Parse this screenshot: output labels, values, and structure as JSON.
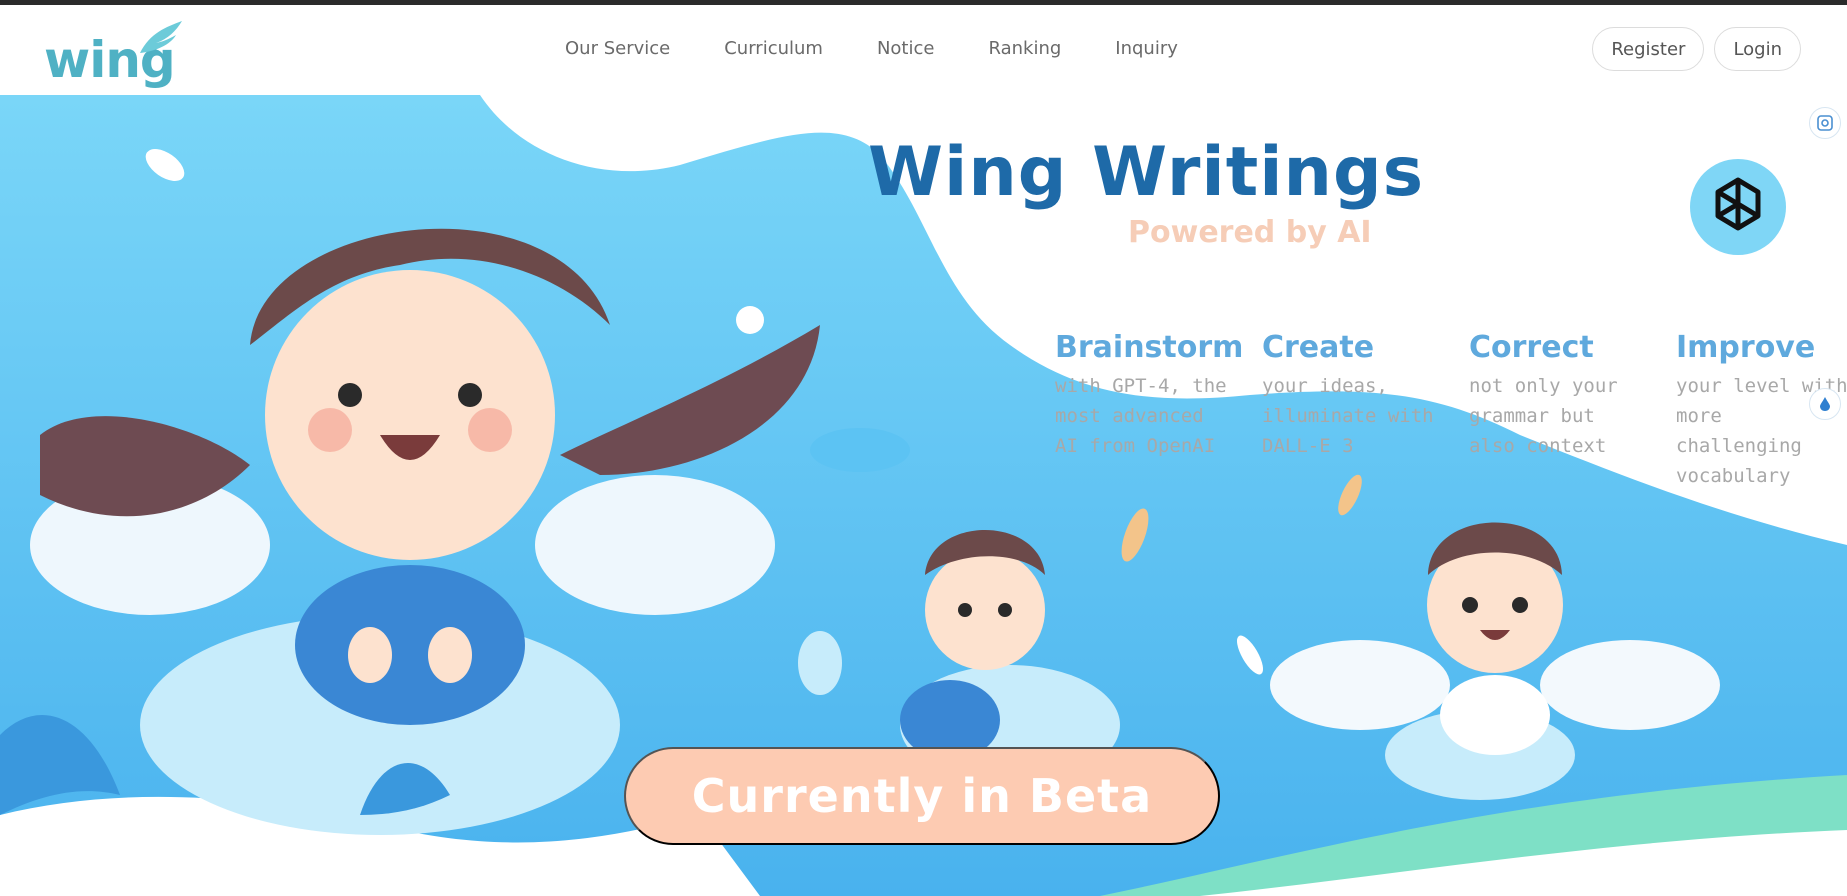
{
  "brand": {
    "logo_text": "wing"
  },
  "nav": {
    "links": [
      "Our Service",
      "Curriculum",
      "Notice",
      "Ranking",
      "Inquiry"
    ],
    "register_label": "Register",
    "login_label": "Login"
  },
  "hero": {
    "title": "Wing Writings",
    "subtitle": "Powered by AI",
    "features": [
      {
        "heading": "Brainstorm",
        "text": "with GPT-4, the most advanced AI from OpenAI"
      },
      {
        "heading": "Create",
        "text": "your ideas, illuminate with DALL-E 3"
      },
      {
        "heading": "Correct",
        "text": "not only your grammar but also context"
      },
      {
        "heading": "Improve",
        "text": "your level with more challenging vocabulary"
      }
    ],
    "cta_label": "Currently in Beta"
  },
  "icons": {
    "openai": "openai-logo-icon",
    "screenshot": "screen-capture-icon",
    "assistant": "assistant-sparkle-icon"
  },
  "colors": {
    "brand_teal": "#4fb1c4",
    "title_blue": "#1e6aa8",
    "feature_blue": "#5fa9dd",
    "peach": "#fdcbb2",
    "sky": "#6fcff5"
  }
}
